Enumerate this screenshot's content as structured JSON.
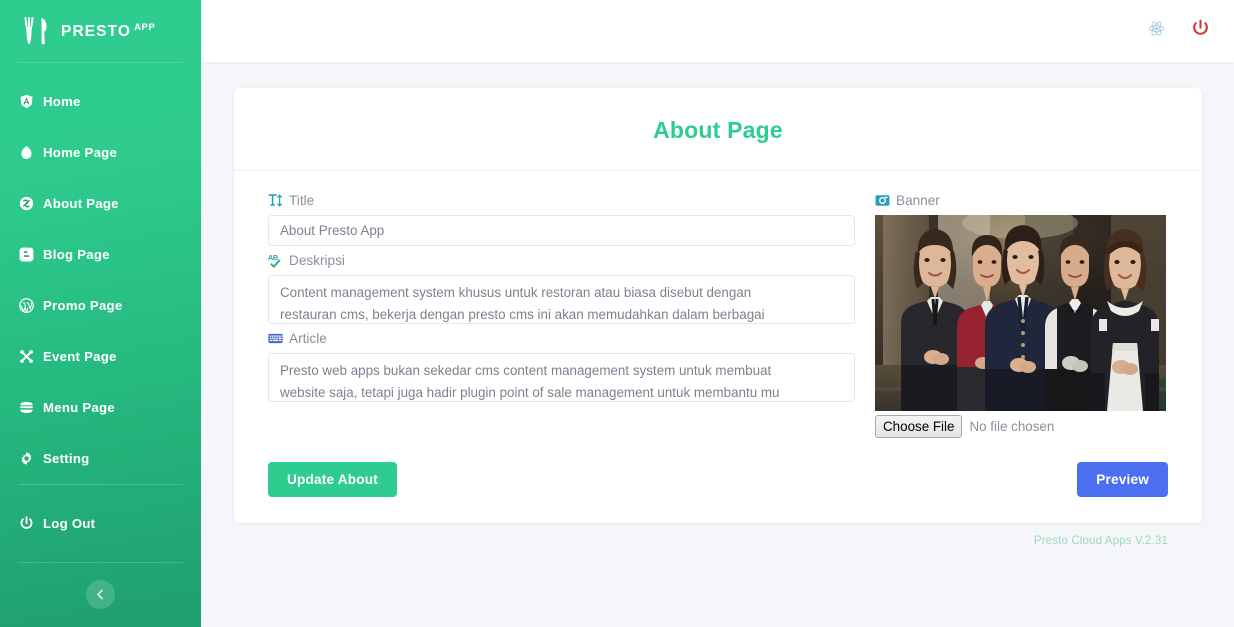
{
  "brand": {
    "name": "PRESTO",
    "suffix": "APP",
    "logo_icon": "fork-knife-icon"
  },
  "sidebar": {
    "items": [
      {
        "label": "Home",
        "icon": "angular-shield-icon",
        "name": "sidebar-item-home"
      },
      {
        "label": "Home Page",
        "icon": "drupal-drop-icon",
        "name": "sidebar-item-home-page"
      },
      {
        "label": "About Page",
        "icon": "joomla-circle-icon",
        "name": "sidebar-item-about-page"
      },
      {
        "label": "Blog Page",
        "icon": "blogger-b-icon",
        "name": "sidebar-item-blog-page"
      },
      {
        "label": "Promo Page",
        "icon": "wordpress-w-icon",
        "name": "sidebar-item-promo-page"
      },
      {
        "label": "Event Page",
        "icon": "joomla-x-icon",
        "name": "sidebar-item-event-page"
      },
      {
        "label": "Menu Page",
        "icon": "burger-icon",
        "name": "sidebar-item-menu-page"
      },
      {
        "label": "Setting",
        "icon": "gear-icon",
        "name": "sidebar-item-setting"
      }
    ],
    "logout": {
      "label": "Log Out",
      "icon": "power-icon"
    },
    "collapse": {
      "icon": "chevron-left-icon"
    }
  },
  "topbar": {
    "icons": [
      {
        "name": "react-atom-icon",
        "color": "#a8cfe0"
      },
      {
        "name": "power-icon",
        "color": "#cf3b36"
      }
    ]
  },
  "card": {
    "title": "About Page",
    "title_color": "#2ecc8f"
  },
  "form": {
    "title": {
      "label": "Title",
      "icon": "text-height-icon",
      "icon_color": "#2a9fb5",
      "value": "About Presto App",
      "placeholder": "Title"
    },
    "deskripsi": {
      "label": "Deskripsi",
      "icon": "spell-check-icon",
      "icon_color": "#2fb57f",
      "value": "Content management system khusus untuk restoran atau biasa disebut dengan restauran cms, bekerja dengan presto cms ini akan memudahkan dalam berbagai",
      "line1": "Content management system khusus untuk restoran atau biasa disebut dengan",
      "line2": "restauran cms, bekerja dengan presto cms ini akan memudahkan dalam berbagai",
      "placeholder": "Deskripsi"
    },
    "article": {
      "label": "Article",
      "icon": "keyboard-icon",
      "icon_color": "#4a63c8",
      "value": "Presto web apps bukan sekedar cms content management system untuk membuat website saja, tetapi juga hadir plugin point of sale management untuk membantu mu",
      "line1": "Presto web apps bukan sekedar cms content management system untuk membuat",
      "line2": "website saja, tetapi juga hadir plugin point of sale management untuk membantu mu",
      "placeholder": "Article"
    },
    "banner": {
      "label": "Banner",
      "icon": "camera-icon",
      "icon_color": "#2a9fb5",
      "image_alt": "restaurant-staff-team-photo",
      "choose_file_label": "Choose File",
      "no_file_label": "No file chosen"
    }
  },
  "buttons": {
    "update": {
      "label": "Update About",
      "color": "#2ecc8f"
    },
    "preview": {
      "label": "Preview",
      "color": "#4c6ef0"
    }
  },
  "footer": {
    "text": "Presto Cloud Apps V.2.31",
    "color": "#9fd9bd"
  }
}
